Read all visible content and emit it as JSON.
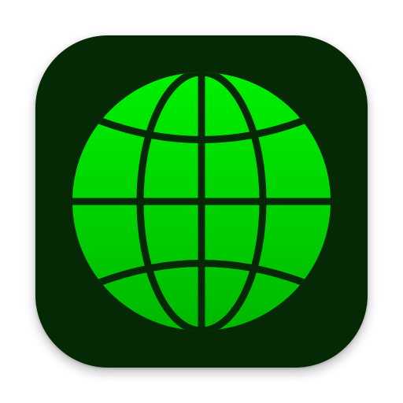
{
  "icon": {
    "name": "globe-icon",
    "colors": {
      "background": "#052805",
      "globe_fill_top": "#00f000",
      "globe_fill_bottom": "#00b800",
      "grid_lines": "#052805"
    }
  }
}
